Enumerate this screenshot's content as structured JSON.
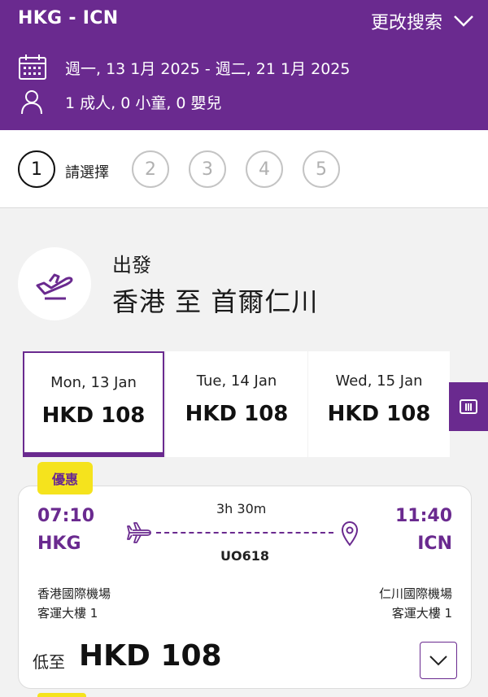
{
  "header": {
    "route": "HKG - ICN",
    "change_search": "更改搜索",
    "dates": "週一, 13 1月 2025  -  週二, 21 1月 2025",
    "passengers": "1 成人, 0 小童, 0 嬰兒"
  },
  "steps": {
    "items": [
      "1",
      "2",
      "3",
      "4",
      "5"
    ],
    "active_label": "請選擇"
  },
  "departure": {
    "label": "出發",
    "route": "香港 至 首爾仁川"
  },
  "date_tabs": [
    {
      "date": "Mon, 13 Jan",
      "price": "HKD 108",
      "selected": true
    },
    {
      "date": "Tue, 14 Jan",
      "price": "HKD 108",
      "selected": false
    },
    {
      "date": "Wed, 15 Jan",
      "price": "HKD 108",
      "selected": false
    }
  ],
  "flight": {
    "promo": "優惠",
    "depart_time": "07:10",
    "depart_code": "HKG",
    "arrive_time": "11:40",
    "arrive_code": "ICN",
    "duration": "3h 30m",
    "flight_no": "UO618",
    "depart_airport": "香港國際機場",
    "depart_terminal": "客運大樓 1",
    "arrive_airport": "仁川國際機場",
    "arrive_terminal": "客運大樓 1",
    "price_prefix": "低至",
    "price": "HKD 108"
  },
  "colors": {
    "brand_purple": "#6a2a8f",
    "promo_yellow": "#f5e31d"
  },
  "icons": [
    "calendar-icon",
    "person-icon",
    "chevron-down-icon",
    "plane-takeoff-icon",
    "calendar-grid-icon",
    "plane-icon",
    "location-pin-icon"
  ]
}
